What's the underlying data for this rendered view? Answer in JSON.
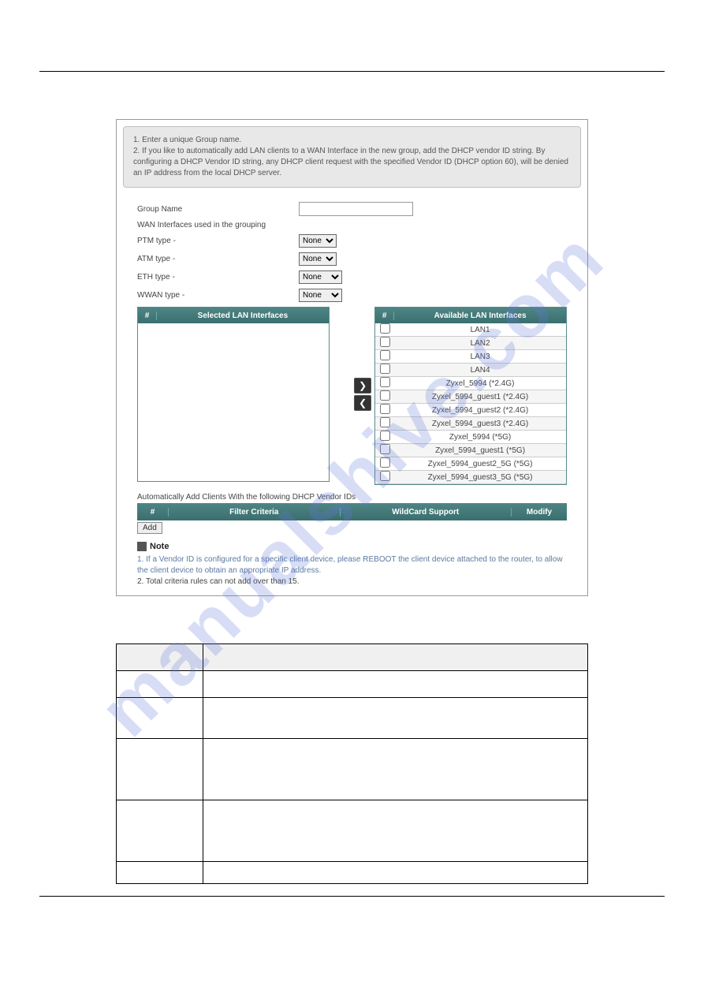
{
  "watermark": "manualshive.com",
  "info": {
    "line1": "1. Enter a unique Group name.",
    "line2": "2. If you like to automatically add LAN clients to a WAN Interface in the new group, add the DHCP vendor ID string. By configuring a DHCP Vendor ID string, any DHCP client request with the specified Vendor ID (DHCP option 60), will be denied an IP address from the local DHCP server."
  },
  "form": {
    "group_name_label": "Group Name",
    "group_name_value": "",
    "wan_label": "WAN Interfaces used in the grouping",
    "ptm_label": "PTM type -",
    "atm_label": "ATM type -",
    "eth_label": "ETH type -",
    "wwan_label": "WWAN type -",
    "none_option": "None"
  },
  "selected": {
    "num": "#",
    "title": "Selected LAN Interfaces"
  },
  "available": {
    "num": "#",
    "title": "Available LAN Interfaces",
    "items": [
      "LAN1",
      "LAN2",
      "LAN3",
      "LAN4",
      "Zyxel_5994 (*2.4G)",
      "Zyxel_5994_guest1 (*2.4G)",
      "Zyxel_5994_guest2 (*2.4G)",
      "Zyxel_5994_guest3 (*2.4G)",
      "Zyxel_5994 (*5G)",
      "Zyxel_5994_guest1 (*5G)",
      "Zyxel_5994_guest2_5G (*5G)",
      "Zyxel_5994_guest3_5G (*5G)"
    ]
  },
  "auto_clients": "Automatically Add Clients With the following DHCP Vendor IDs",
  "criteria": {
    "c1": "#",
    "c2": "Filter Criteria",
    "c3": "WildCard Support",
    "c4": "Modify"
  },
  "add_label": "Add",
  "note_title": "Note",
  "note1": "1. If a Vendor ID is configured for a specific client device, please REBOOT the client device attached to the router, to allow the client device to obtain an appropriate IP address.",
  "note2": "2. Total criteria rules can not add over than 15.",
  "transfer": {
    "right": "❯",
    "left": "❮"
  }
}
